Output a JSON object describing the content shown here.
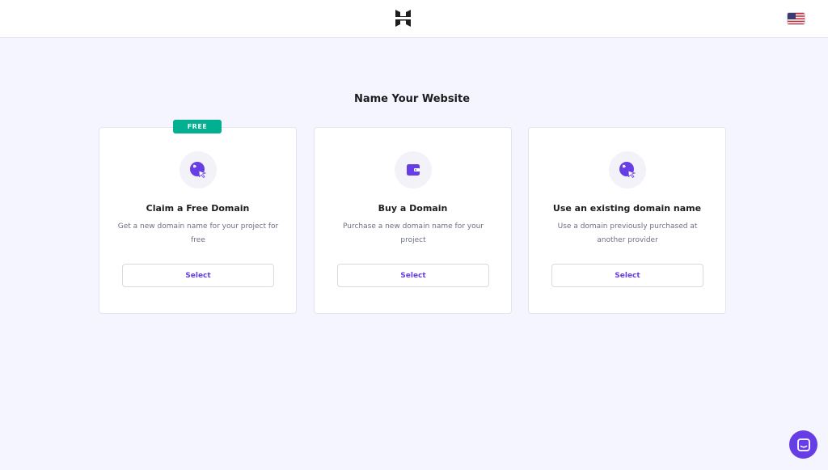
{
  "header": {
    "logo_icon": "hostinger-logo-icon",
    "language_icon": "us-flag-icon"
  },
  "main": {
    "title": "Name Your Website",
    "cards": [
      {
        "badge": "FREE",
        "icon": "globe-cursor-icon",
        "title": "Claim a Free Domain",
        "description": "Get a new domain name for your project for free",
        "button_label": "Select"
      },
      {
        "icon": "wallet-icon",
        "title": "Buy a Domain",
        "description": "Purchase a new domain name for your project",
        "button_label": "Select"
      },
      {
        "icon": "globe-cursor-icon",
        "title": "Use an existing domain name",
        "description": "Use a domain previously purchased at another provider",
        "button_label": "Select"
      }
    ]
  },
  "chat": {
    "icon": "chat-icon"
  },
  "colors": {
    "accent": "#673de6",
    "badge": "#00b090",
    "background": "#f4f5fe"
  }
}
